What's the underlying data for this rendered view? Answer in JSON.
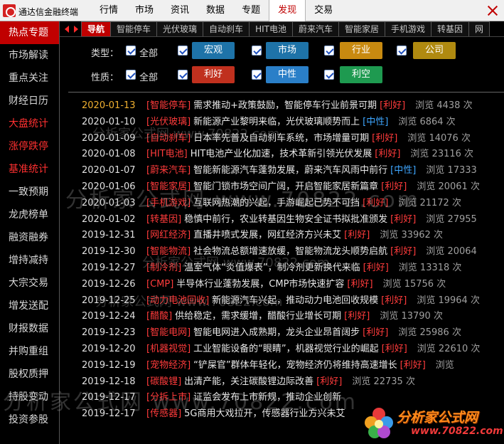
{
  "app": {
    "title": "通达信金融终端"
  },
  "menu": [
    "行情",
    "市场",
    "资讯",
    "数据",
    "专题",
    "发现",
    "交易"
  ],
  "menu_active_index": 5,
  "sidebar": [
    {
      "label": "热点专题",
      "style": "active"
    },
    {
      "label": "市场解读",
      "style": ""
    },
    {
      "label": "重点关注",
      "style": ""
    },
    {
      "label": "财经日历",
      "style": ""
    },
    {
      "label": "大盘统计",
      "style": "red"
    },
    {
      "label": "涨停跌停",
      "style": "red"
    },
    {
      "label": "基准统计",
      "style": "red"
    },
    {
      "label": "一致预期",
      "style": ""
    },
    {
      "label": "龙虎榜单",
      "style": ""
    },
    {
      "label": "融资融券",
      "style": ""
    },
    {
      "label": "增持减持",
      "style": ""
    },
    {
      "label": "大宗交易",
      "style": ""
    },
    {
      "label": "增发送配",
      "style": ""
    },
    {
      "label": "财报数据",
      "style": ""
    },
    {
      "label": "并购重组",
      "style": ""
    },
    {
      "label": "股权质押",
      "style": ""
    },
    {
      "label": "持股变动",
      "style": ""
    },
    {
      "label": "投资参股",
      "style": ""
    }
  ],
  "tabs": [
    "导航",
    "智能停车",
    "光伏玻璃",
    "自动刹车",
    "HIT电池",
    "蔚来汽车",
    "智能家居",
    "手机游戏",
    "转基因",
    "网"
  ],
  "filters": {
    "type_label": "类型：",
    "type_all": "全部",
    "types": [
      {
        "label": "宏观",
        "color": "#1e73a8"
      },
      {
        "label": "市场",
        "color": "#1e73a8"
      },
      {
        "label": "行业",
        "color": "#c88a10"
      },
      {
        "label": "公司",
        "color": "#b08a10"
      }
    ],
    "nature_label": "性质：",
    "nature_all": "全部",
    "natures": [
      {
        "label": "利好",
        "color": "#c0301e"
      },
      {
        "label": "中性",
        "color": "#2a7fc8"
      },
      {
        "label": "利空",
        "color": "#1e9a50"
      }
    ]
  },
  "news": [
    {
      "date": "2020-01-13",
      "highlight": true,
      "category": "[智能停车]",
      "title": "需求推动+政策鼓励，智能停车行业前景可期",
      "rating": "[利好]",
      "rating_type": "pos",
      "views": "浏览 4438 次"
    },
    {
      "date": "2020-01-10",
      "highlight": false,
      "category": "[光伏玻璃]",
      "title": "新能源产业黎明来临，光伏玻璃顺势而上",
      "rating": "[中性]",
      "rating_type": "neu",
      "views": "浏览 6864 次"
    },
    {
      "date": "2020-01-09",
      "highlight": false,
      "category": "[自动刹车]",
      "title": "日本率先普及自动刹车系统，市场增量可期",
      "rating": "[利好]",
      "rating_type": "pos",
      "views": "浏览 14076 次"
    },
    {
      "date": "2020-01-08",
      "highlight": false,
      "category": "[HIT电池]",
      "title": "HIT电池产业化加速，技术革新引领光伏发展",
      "rating": "[利好]",
      "rating_type": "pos",
      "views": "浏览 23116 次"
    },
    {
      "date": "2020-01-07",
      "highlight": false,
      "category": "[蔚来汽车]",
      "title": "智能新能源汽车蓬勃发展，蔚来汽车风雨中前行",
      "rating": "[中性]",
      "rating_type": "neu",
      "views": "浏览 17333"
    },
    {
      "date": "2020-01-06",
      "highlight": false,
      "category": "[智能家居]",
      "title": "智能门锁市场空间广阔，开启智能家居新篇章",
      "rating": "[利好]",
      "rating_type": "pos",
      "views": "浏览 20061 次"
    },
    {
      "date": "2020-01-03",
      "highlight": false,
      "category": "[手机游戏]",
      "title": "互联网热潮的兴起，手游崛起已势不可挡",
      "rating": "[利好]",
      "rating_type": "pos",
      "views": "浏览 21172 次"
    },
    {
      "date": "2020-01-02",
      "highlight": false,
      "category": "[转基因]",
      "title": "稳慎中前行，农业转基因生物安全证书拟批准颁发",
      "rating": "[利好]",
      "rating_type": "pos",
      "views": "浏览 27955"
    },
    {
      "date": "2019-12-31",
      "highlight": false,
      "category": "[网红经济]",
      "title": "直播井喷式发展，网红经济方兴未艾",
      "rating": "[利好]",
      "rating_type": "pos",
      "views": "浏览 33962 次"
    },
    {
      "date": "2019-12-30",
      "highlight": false,
      "category": "[智能物流]",
      "title": "社会物流总额增速放缓，智能物流龙头顺势启航",
      "rating": "[利好]",
      "rating_type": "pos",
      "views": "浏览 20064"
    },
    {
      "date": "2019-12-27",
      "highlight": false,
      "category": "[制冷剂]",
      "title": "温室气体“炎值爆表”，制冷剂更新换代来临",
      "rating": "[利好]",
      "rating_type": "pos",
      "views": "浏览 13318 次"
    },
    {
      "date": "2019-12-26",
      "highlight": false,
      "category": "[CMP]",
      "title": "半导体行业蓬勃发展，CMP市场快速扩容",
      "rating": "[利好]",
      "rating_type": "pos",
      "views": "浏览 15756 次"
    },
    {
      "date": "2019-12-25",
      "highlight": false,
      "category": "[动力电池回收]",
      "title": "新能源汽车兴起，推动动力电池回收规模",
      "rating": "[利好]",
      "rating_type": "pos",
      "views": "浏览 19964 次"
    },
    {
      "date": "2019-12-24",
      "highlight": false,
      "category": "[醋酸]",
      "title": "供给稳定，需求缓增，醋酸行业增长可期",
      "rating": "[利好]",
      "rating_type": "pos",
      "views": "浏览 13790 次"
    },
    {
      "date": "2019-12-23",
      "highlight": false,
      "category": "[智能电网]",
      "title": "智能电网进入成熟期，龙头企业昂首阔步",
      "rating": "[利好]",
      "rating_type": "pos",
      "views": "浏览 25986 次"
    },
    {
      "date": "2019-12-20",
      "highlight": false,
      "category": "[机器视觉]",
      "title": "工业智能设备的“眼睛”，机器视觉行业的崛起",
      "rating": "[利好]",
      "rating_type": "pos",
      "views": "浏览 22610 次"
    },
    {
      "date": "2019-12-19",
      "highlight": false,
      "category": "[宠物经济]",
      "title": "“铲屎官”群体年轻化，宠物经济仍将维持高速增长",
      "rating": "[利好]",
      "rating_type": "pos",
      "views": "浏览"
    },
    {
      "date": "2019-12-18",
      "highlight": false,
      "category": "[碳酸锂]",
      "title": "出清产能，关注碳酸锂边际改善",
      "rating": "[利好]",
      "rating_type": "pos",
      "views": "浏览 22735 次"
    },
    {
      "date": "2019-12-17",
      "highlight": false,
      "category": "[分拆上市]",
      "title": "证监会发布上市新规，推动企业创新",
      "rating": "",
      "rating_type": "pos",
      "views": ""
    },
    {
      "date": "2019-12-17",
      "highlight": false,
      "category": "[传感器]",
      "title": "5G商用大戏拉开，传感器行业方兴未艾",
      "rating": "",
      "rating_type": "pos",
      "views": ""
    }
  ],
  "watermark": {
    "line1": "分析家公式网 www.70822.com",
    "line2": "分析家公式网 www.70822.com",
    "line3": "分析家公式网 www.70822.com",
    "line4": "分析家公式网 www.70822.com",
    "line5": "分析家公式网 www.70822.com"
  },
  "corner_logo": {
    "title": "分析家公式网",
    "url": "www.70822.com"
  }
}
